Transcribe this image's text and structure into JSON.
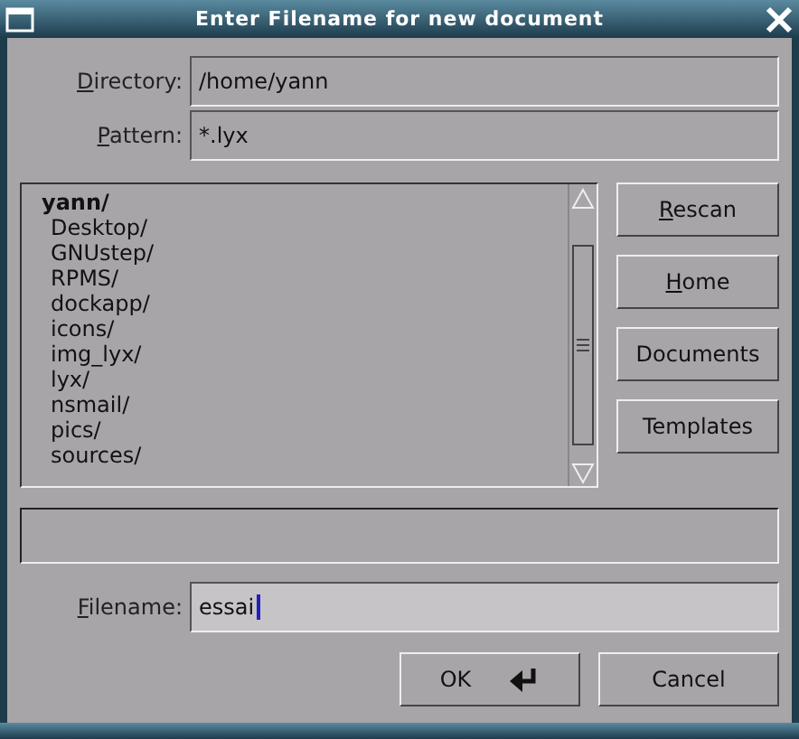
{
  "window": {
    "title": "Enter Filename for new document"
  },
  "fields": [
    {
      "label": "Directory:",
      "mnemonic": true,
      "value": "/home/yann"
    },
    {
      "label": "Pattern:",
      "mnemonic": true,
      "value": "*.lyx"
    }
  ],
  "listing": {
    "name": "yann/",
    "children": [
      {
        "name": "Desktop/"
      },
      {
        "name": "GNUstep/"
      },
      {
        "name": "RPMS/"
      },
      {
        "name": "dockapp/"
      },
      {
        "name": "icons/"
      },
      {
        "name": "img_lyx/"
      },
      {
        "name": "lyx/"
      },
      {
        "name": "nsmail/"
      },
      {
        "name": "pics/"
      },
      {
        "name": "sources/"
      }
    ]
  },
  "side_buttons": [
    {
      "label": "Rescan",
      "mnemonic": true
    },
    {
      "label": "Home",
      "mnemonic": true
    },
    {
      "label": "Documents",
      "mnemonic": false
    },
    {
      "label": "Templates",
      "mnemonic": false
    }
  ],
  "filename": {
    "label": "Filename:",
    "mnemonic": true,
    "value": "essai"
  },
  "buttons": [
    {
      "label": "OK",
      "kind": "default"
    },
    {
      "label": "Cancel",
      "kind": "plain"
    }
  ]
}
